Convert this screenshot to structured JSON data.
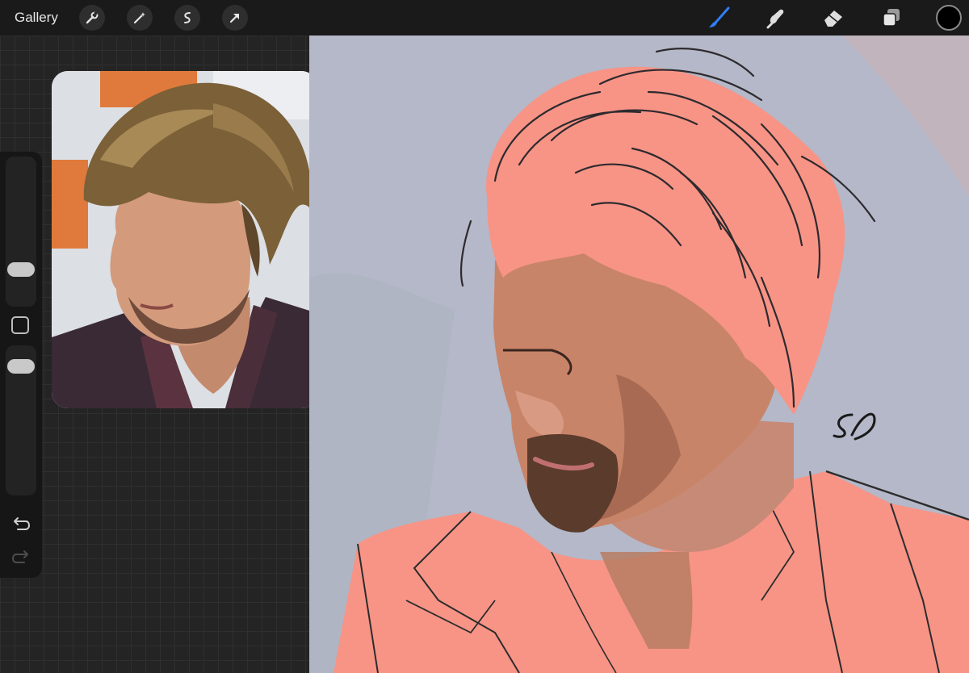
{
  "toolbar": {
    "gallery_label": "Gallery",
    "left_tools": [
      "wrench-icon",
      "magic-wand-icon",
      "selection-icon",
      "transform-arrow-icon"
    ],
    "right_tools": [
      "brush-icon",
      "smudge-icon",
      "eraser-icon",
      "layers-icon"
    ],
    "active_tool": "brush-icon",
    "current_color": "#000000",
    "accent_color": "#2f7ff5"
  },
  "sidebar": {
    "controls": [
      "brush-size-slider",
      "modify-button",
      "opacity-slider",
      "undo-icon",
      "redo-icon"
    ]
  },
  "reference": {
    "description_icon": "reference-photo"
  },
  "canvas": {
    "signature_icon": "artist-signature"
  }
}
